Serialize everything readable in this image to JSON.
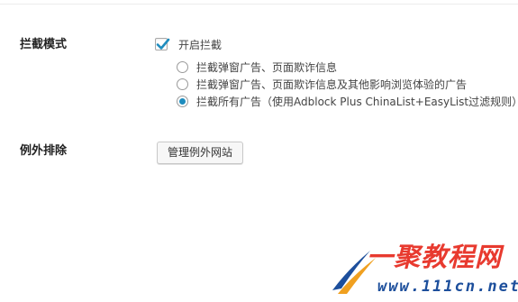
{
  "settings": {
    "block_mode": {
      "label": "拦截模式",
      "enable_checkbox": {
        "label": "开启拦截",
        "checked": true
      },
      "options": [
        {
          "label": "拦截弹窗广告、页面欺诈信息",
          "selected": false
        },
        {
          "label": "拦截弹窗广告、页面欺诈信息及其他影响浏览体验的广告",
          "selected": false
        },
        {
          "label": "拦截所有广告（使用Adblock Plus ChinaList+EasyList过滤规则）",
          "selected": true
        }
      ]
    },
    "exceptions": {
      "label": "例外排除",
      "manage_button_label": "管理例外网站"
    }
  },
  "watermark": {
    "brand": "一聚教程网",
    "url": "www.111cn.net"
  },
  "colors": {
    "accent": "#1e8cbe",
    "checkmark": "#1e8cbe",
    "watermark_red": "#e83a2f",
    "watermark_blue": "#1d4f9c"
  }
}
